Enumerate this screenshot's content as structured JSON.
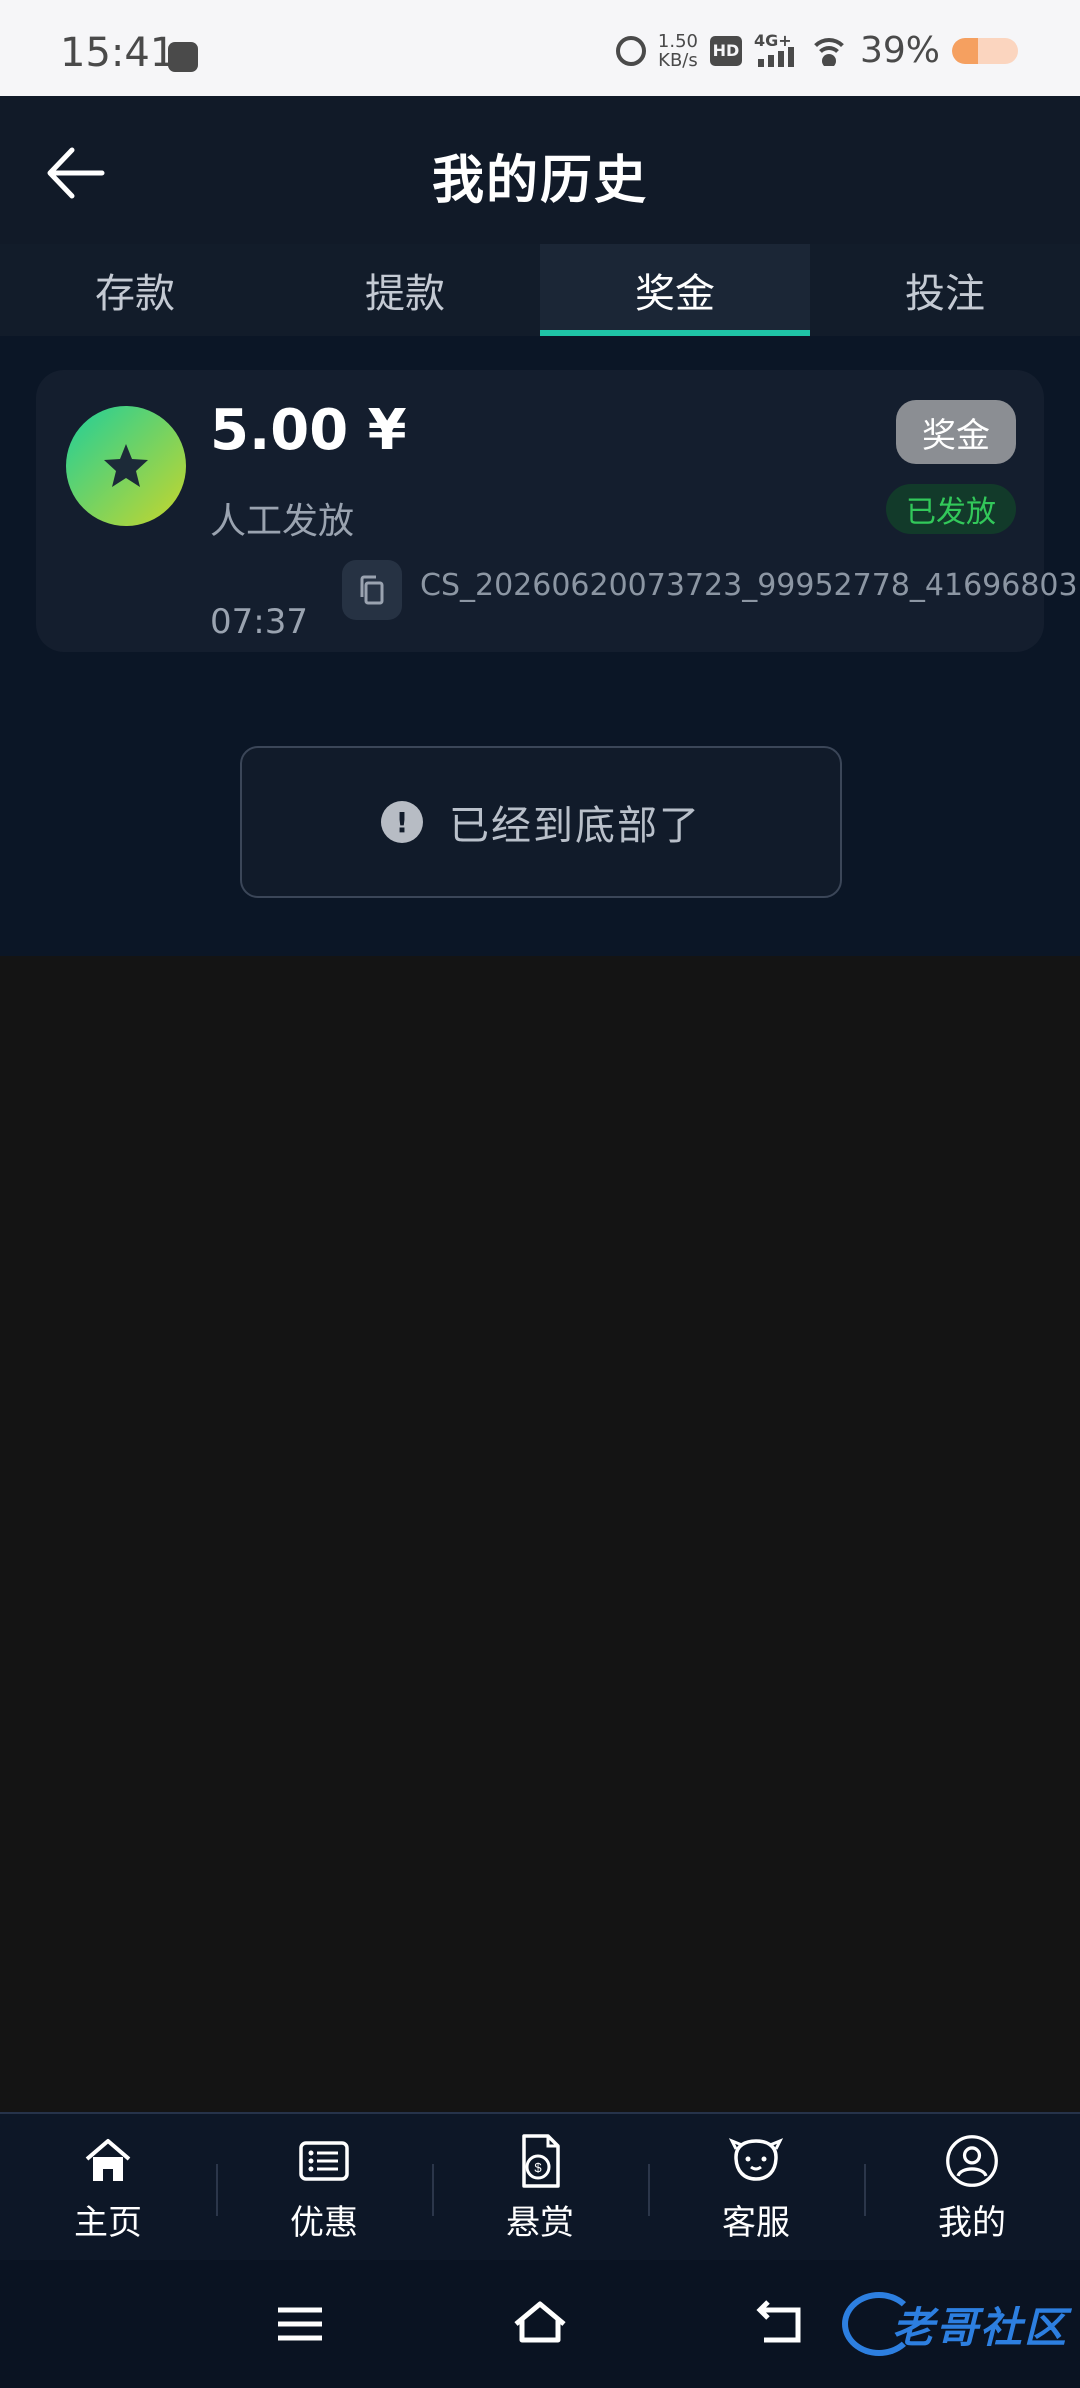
{
  "status_bar": {
    "time": "15:41",
    "net_speed_value": "1.50",
    "net_speed_unit": "KB/s",
    "hd": "HD",
    "network": "4G+",
    "battery_text": "39%",
    "battery_level": 0.39
  },
  "header": {
    "title": "我的历史"
  },
  "tabs": [
    {
      "label": "存款"
    },
    {
      "label": "提款"
    },
    {
      "label": "奖金",
      "active": true
    },
    {
      "label": "投注"
    }
  ],
  "record": {
    "amount": "5.00 ¥",
    "description": "人工发放",
    "type": "奖金",
    "status": "已发放",
    "time": "07:37",
    "transaction_id": "CS_20260620073723_99952778_41696803"
  },
  "end_message": "已经到底部了",
  "bottom_nav": [
    {
      "label": "主页",
      "icon": "home-icon"
    },
    {
      "label": "优惠",
      "icon": "promo-list-icon"
    },
    {
      "label": "悬赏",
      "icon": "reward-document-icon"
    },
    {
      "label": "客服",
      "icon": "customer-service-icon"
    },
    {
      "label": "我的",
      "icon": "profile-icon"
    }
  ],
  "watermark": {
    "text": "老哥社区"
  },
  "colors": {
    "accent": "#1fc3a6",
    "status_green": "#32c85a",
    "watermark_blue": "#2d7fe0"
  }
}
